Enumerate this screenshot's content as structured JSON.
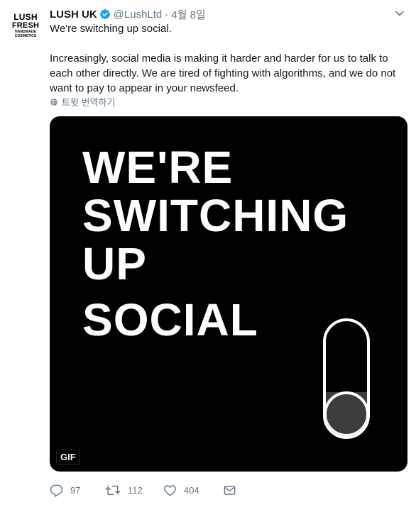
{
  "avatar": {
    "line1": "LUSH",
    "line2": "FRESH",
    "line3": "HANDMADE",
    "line4": "COSMETICS"
  },
  "tweet": {
    "name": "LUSH UK",
    "handle": "@LushLtd",
    "separator": "·",
    "date": "4월 8일",
    "paragraph1": "We're switching up social.",
    "paragraph2": "Increasingly, social media is making it harder and harder for us to talk to each other directly. We are tired of fighting with algorithms, and we do not want to pay to appear in your newsfeed.",
    "translate_label": "트윗 번역하기"
  },
  "media": {
    "lines": [
      "WE'RE",
      "SWITCHING",
      "UP",
      "SOCIAL"
    ],
    "badge": "GIF",
    "toggle_position": "off"
  },
  "actions": {
    "replies": "97",
    "retweets": "112",
    "likes": "404"
  },
  "icons": {
    "verified": "verified-badge-icon",
    "menu": "chevron-down-icon",
    "translate": "globe-icon",
    "reply": "reply-icon",
    "retweet": "retweet-icon",
    "like": "heart-icon",
    "share": "envelope-icon"
  },
  "colors": {
    "verified": "#1da1f2",
    "secondary_text": "#657786",
    "media_bg": "#000000",
    "text": "#14171a"
  }
}
